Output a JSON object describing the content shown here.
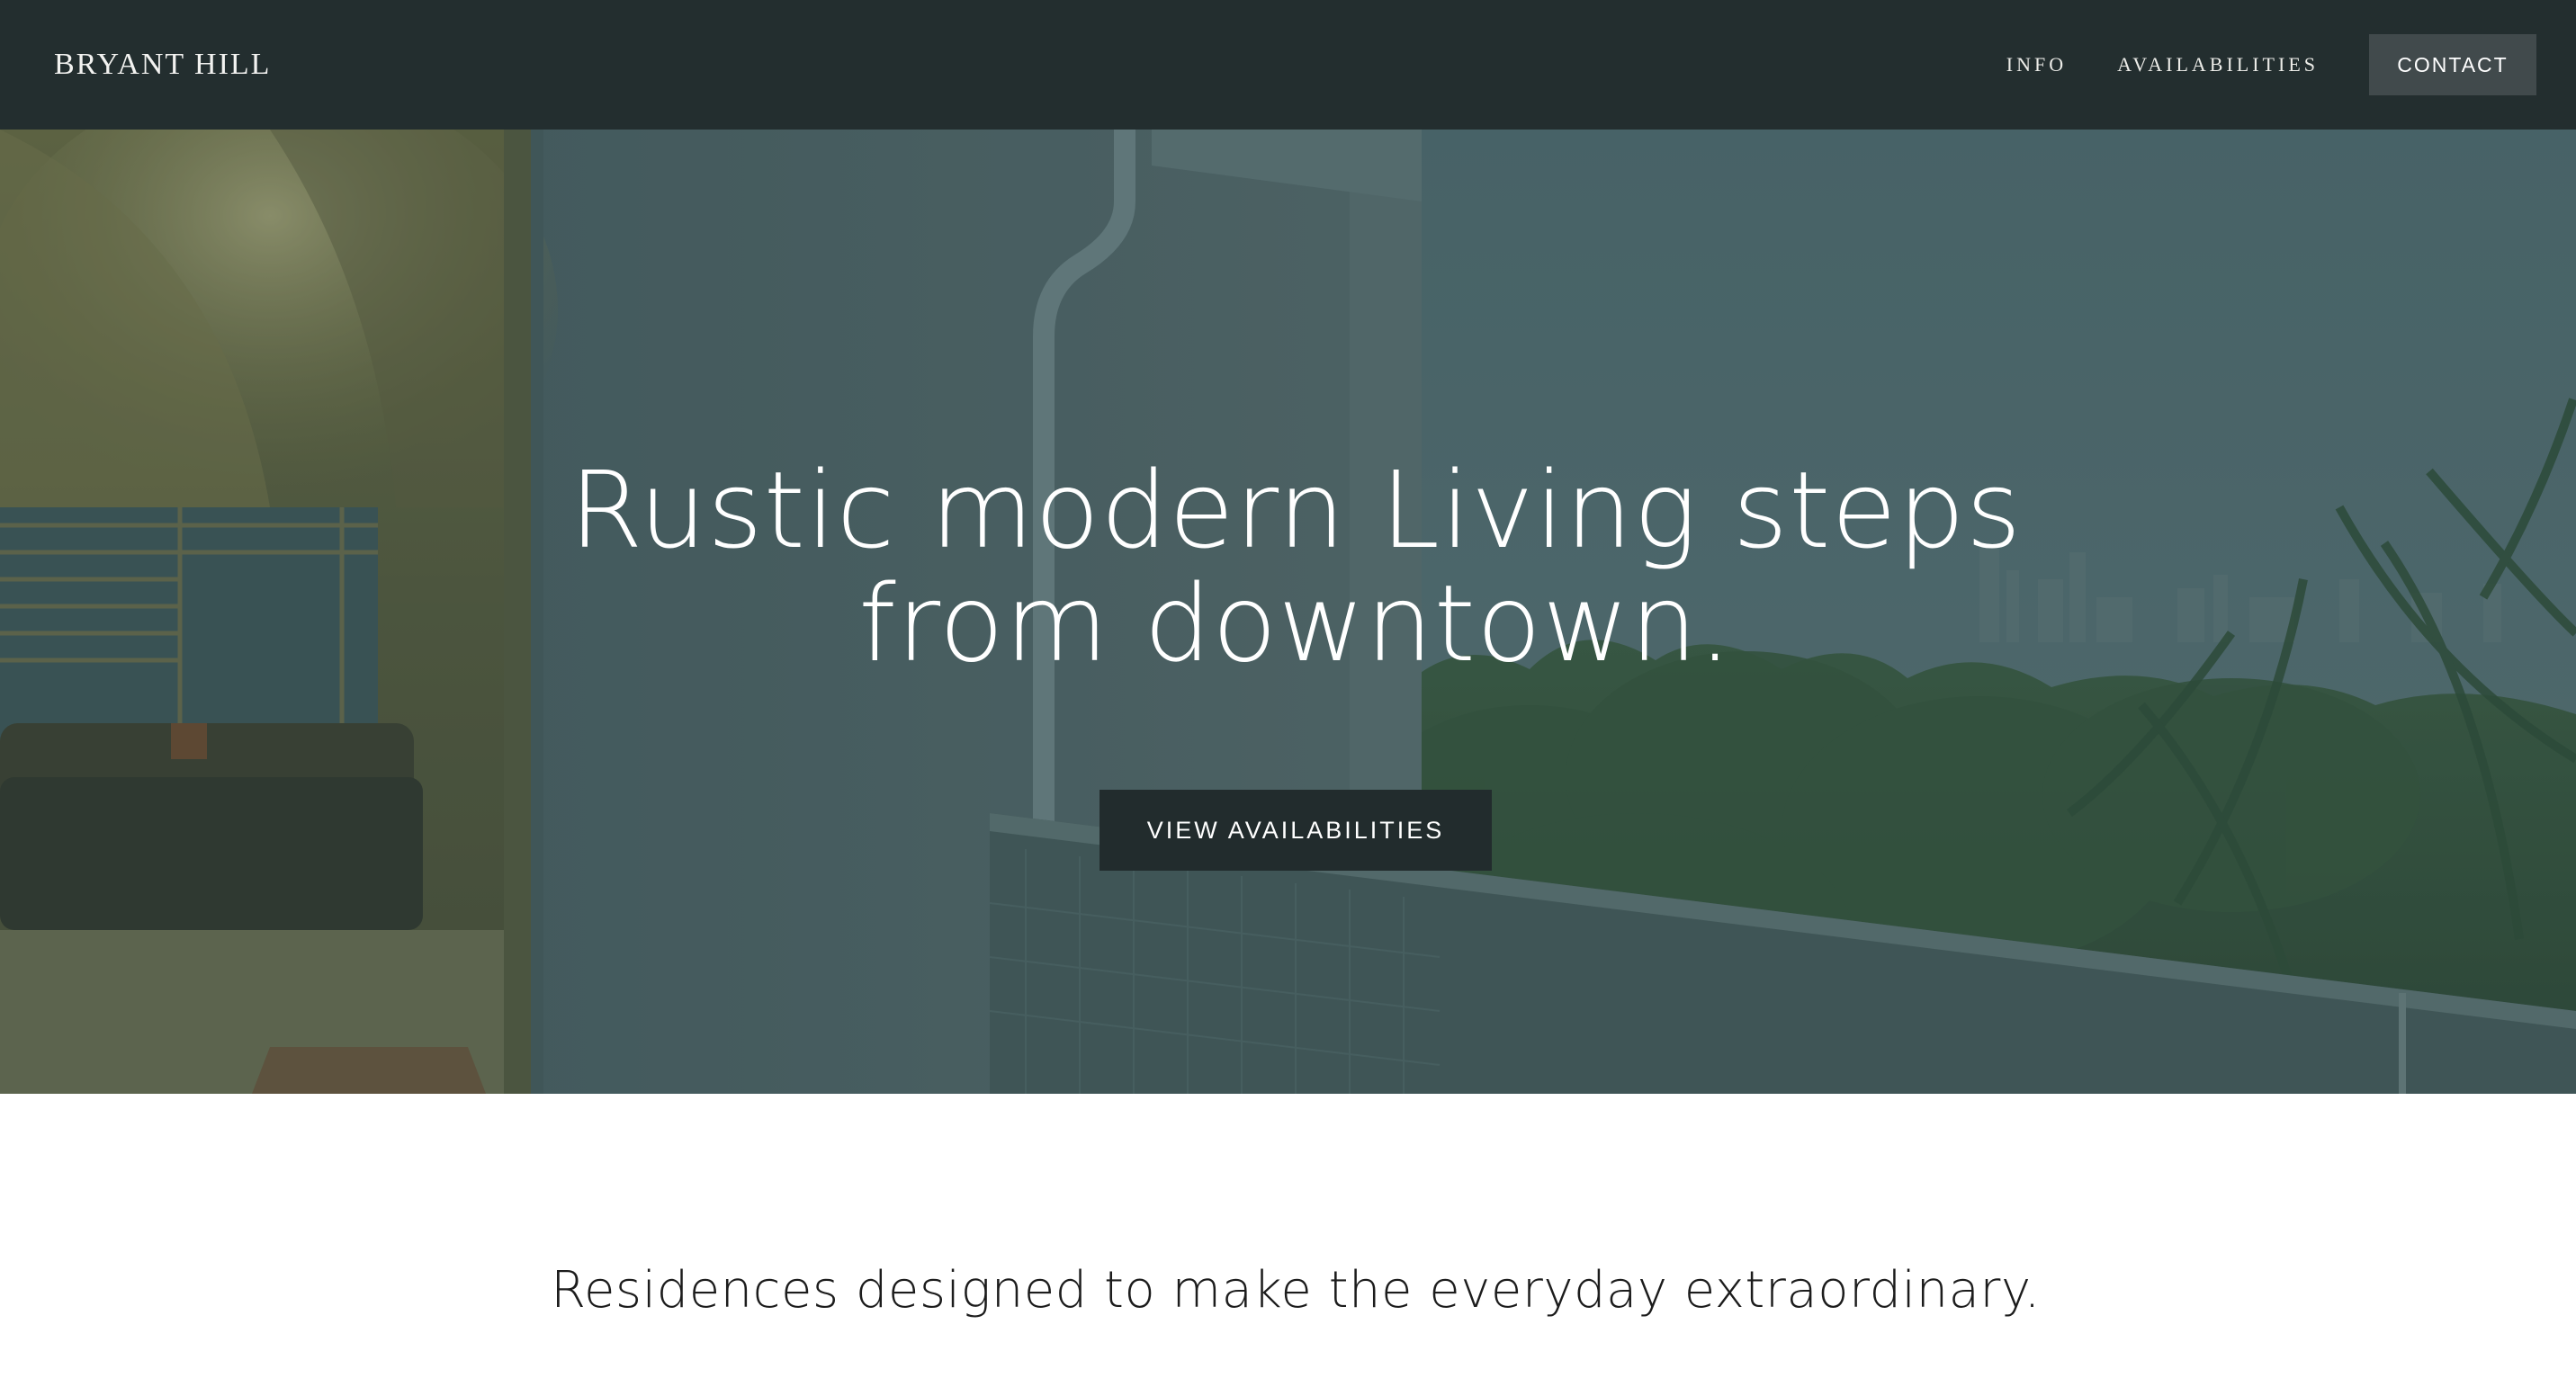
{
  "header": {
    "brand": "BRYANT HILL",
    "nav": {
      "info": "INFO",
      "availabilities": "AVAILABILITIES",
      "contact": "CONTACT"
    }
  },
  "hero": {
    "title": "Rustic modern Living steps\nfrom downtown.",
    "cta_label": "VIEW AVAILABILITIES",
    "overlay_color": "#2f4a4c"
  },
  "intro": {
    "text": "Residences designed to make the everyday extraordinary."
  },
  "colors": {
    "nav_background": "#232e2f",
    "contact_button": "#414a4c",
    "cta_button": "#222c2d"
  }
}
